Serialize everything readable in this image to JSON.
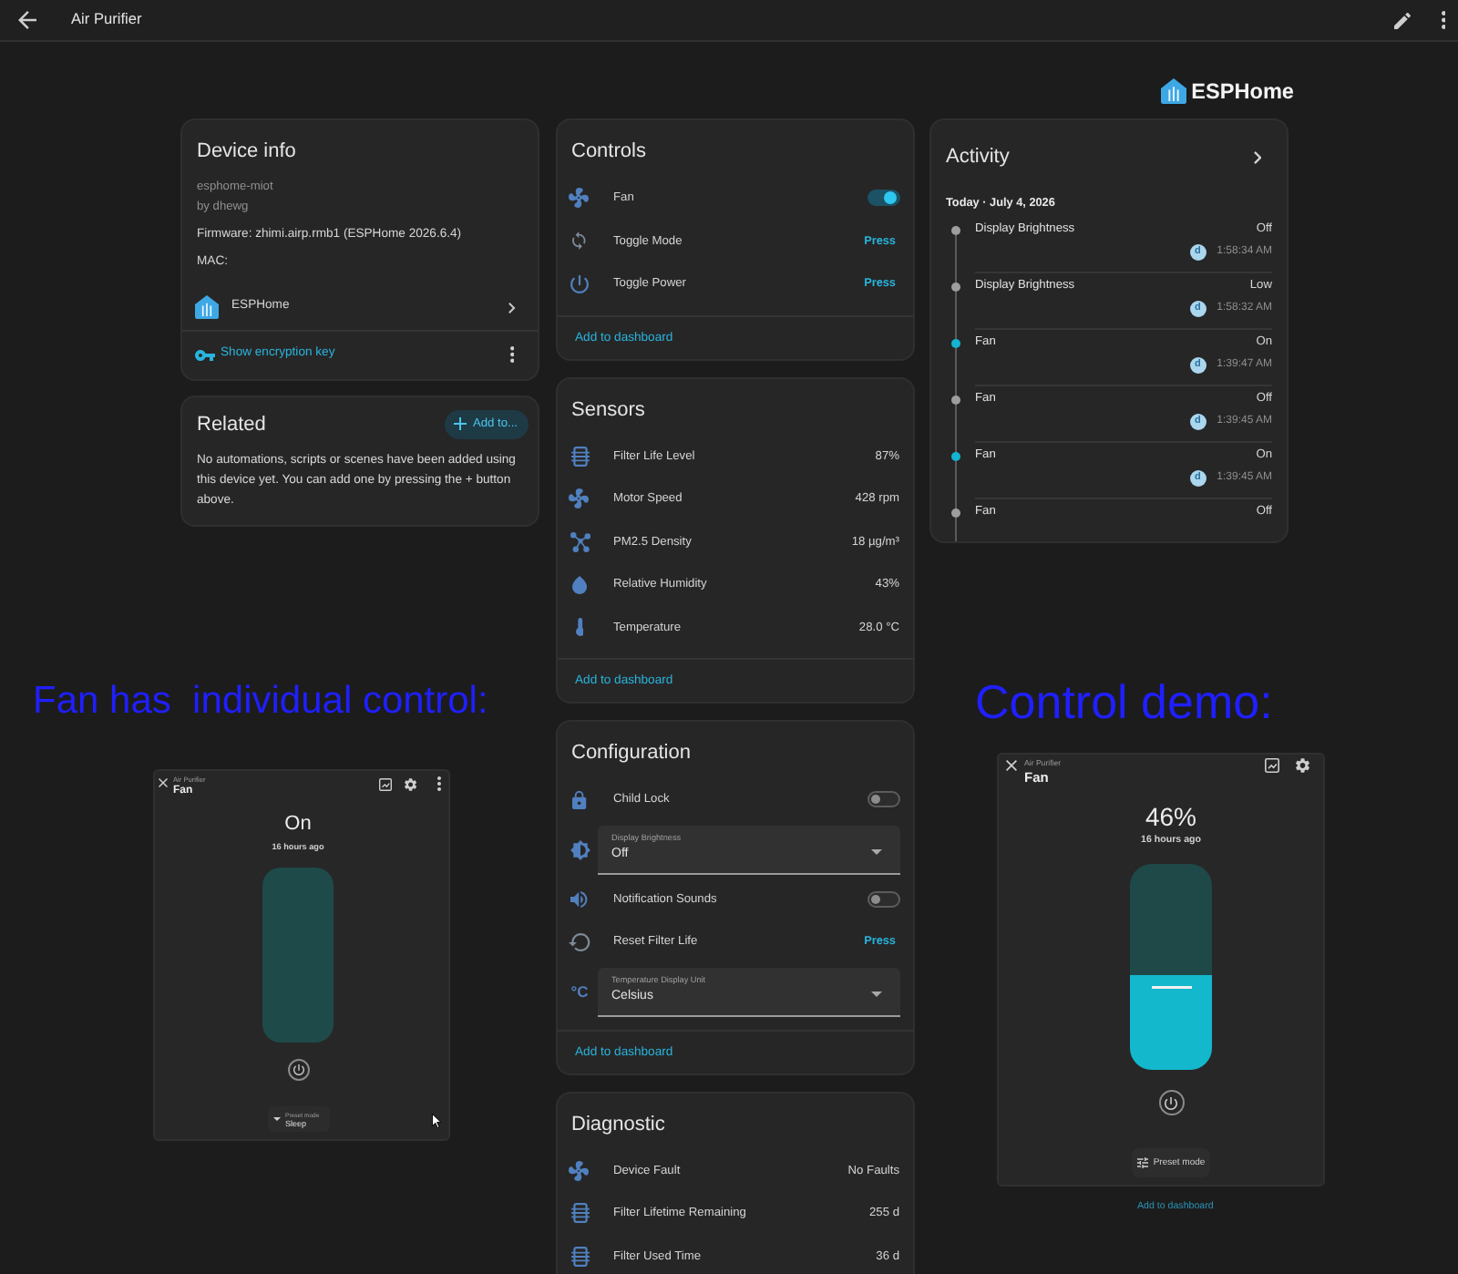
{
  "top_bar": {
    "title": "Air Purifier"
  },
  "brand": {
    "name": "ESPHome"
  },
  "device_info": {
    "title": "Device info",
    "model": "esphome-miot",
    "manufacturer": "by dhewg",
    "firmware": "Firmware: zhimi.airp.rmb1 (ESPHome 2026.6.4)",
    "mac": "MAC:",
    "integration": "ESPHome",
    "encryption_link": "Show encryption key"
  },
  "related": {
    "title": "Related",
    "add_button": "Add to...",
    "message": "No automations, scripts or scenes have been added using this device yet. You can add one by pressing the + button above."
  },
  "controls": {
    "title": "Controls",
    "rows": [
      {
        "kind": "toggle",
        "label": "Fan",
        "on": true
      },
      {
        "kind": "button",
        "label": "Toggle Mode",
        "action": "Press"
      },
      {
        "kind": "button",
        "label": "Toggle Power",
        "action": "Press"
      }
    ],
    "footer_link": "Add to dashboard"
  },
  "sensors": {
    "title": "Sensors",
    "rows": [
      {
        "label": "Filter Life Level",
        "value": "87%"
      },
      {
        "label": "Motor Speed",
        "value": "428 rpm"
      },
      {
        "label": "PM2.5 Density",
        "value": "18 µg/m³"
      },
      {
        "label": "Relative Humidity",
        "value": "43%"
      },
      {
        "label": "Temperature",
        "value": "28.0 °C"
      }
    ],
    "footer_link": "Add to dashboard"
  },
  "configuration": {
    "title": "Configuration",
    "rows": [
      {
        "kind": "toggle",
        "label": "Child Lock",
        "on": false
      },
      {
        "kind": "select",
        "label": "Display Brightness",
        "value": "Off"
      },
      {
        "kind": "toggle",
        "label": "Notification Sounds",
        "on": false
      },
      {
        "kind": "button",
        "label": "Reset Filter Life",
        "action": "Press"
      },
      {
        "kind": "select",
        "label": "Temperature Display Unit",
        "value": "Celsius",
        "symbol": "°C"
      }
    ],
    "footer_link": "Add to dashboard"
  },
  "diagnostic": {
    "title": "Diagnostic",
    "rows": [
      {
        "label": "Device Fault",
        "value": "No Faults"
      },
      {
        "label": "Filter Lifetime Remaining",
        "value": "255 d"
      },
      {
        "label": "Filter Used Time",
        "value": "36 d"
      }
    ]
  },
  "activity": {
    "title": "Activity",
    "date": "Today · July 4, 2026",
    "entries": [
      {
        "name": "Display Brightness",
        "state": "Off",
        "user": "d",
        "time": "1:58:34 AM",
        "color": "#9e9e9e"
      },
      {
        "name": "Display Brightness",
        "state": "Low",
        "user": "d",
        "time": "1:58:32 AM",
        "color": "#9e9e9e"
      },
      {
        "name": "Fan",
        "state": "On",
        "user": "d",
        "time": "1:39:47 AM",
        "color": "#14b4d2"
      },
      {
        "name": "Fan",
        "state": "Off",
        "user": "d",
        "time": "1:39:45 AM",
        "color": "#9e9e9e"
      },
      {
        "name": "Fan",
        "state": "On",
        "user": "d",
        "time": "1:39:45 AM",
        "color": "#14b4d2"
      },
      {
        "name": "Fan",
        "state": "Off",
        "color": "#9e9e9e"
      }
    ]
  },
  "demos": [
    {
      "caption": "Fan has  individual control:",
      "dialog": {
        "kind": "toggle",
        "subtitle": "Air Purifier",
        "title": "Fan",
        "state": "On",
        "changed": "16 hours ago",
        "more_menu": true,
        "preset_label": "Preset mode",
        "preset_value": "Sleep",
        "pointer_visible": true
      }
    },
    {
      "caption": "Control demo:",
      "dialog": {
        "kind": "slider",
        "subtitle": "Air Purifier",
        "title": "Fan",
        "state": "46%",
        "changed": "16 hours ago",
        "more_menu": false,
        "level": 0.46,
        "preset_button": "Preset mode",
        "pointer_visible": false
      },
      "footer_link": "Add to dashboard"
    }
  ]
}
